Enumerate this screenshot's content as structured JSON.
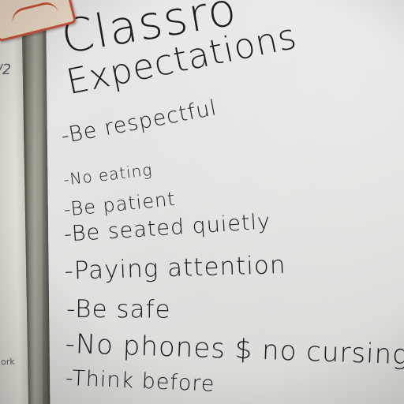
{
  "left_sheet": {
    "fragment_top": "/2",
    "fragment_bottom": "ork"
  },
  "chart": {
    "title_line_1": "Classro",
    "title_line_2": "Expectations",
    "items": [
      "-Be respectful",
      "-No eating",
      "-Be patient",
      "-Be seated quietly",
      "-Paying attention",
      "-Be safe",
      "-No phones $ no cursing",
      "-Think before"
    ],
    "ink_color": "#1c1c22",
    "paper_color": "#e6e5e3"
  },
  "sticker": {
    "border_color": "#c6533b"
  }
}
